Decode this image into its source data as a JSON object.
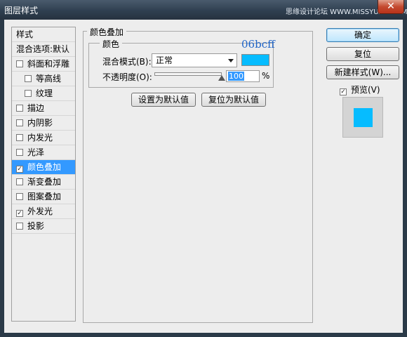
{
  "window": {
    "title": "图层样式",
    "watermark": "思缘设计论坛 WWW.MISSYUAN.COM",
    "close_glyph": "✕"
  },
  "left_panel": {
    "header": "样式",
    "blend_options": "混合选项:默认",
    "items": [
      {
        "label": "斜面和浮雕",
        "checked": false,
        "selected": false
      },
      {
        "label": "等高线",
        "checked": false,
        "selected": false,
        "indent": true
      },
      {
        "label": "纹理",
        "checked": false,
        "selected": false,
        "indent": true
      },
      {
        "label": "描边",
        "checked": false,
        "selected": false
      },
      {
        "label": "内阴影",
        "checked": false,
        "selected": false
      },
      {
        "label": "内发光",
        "checked": false,
        "selected": false
      },
      {
        "label": "光泽",
        "checked": false,
        "selected": false
      },
      {
        "label": "颜色叠加",
        "checked": true,
        "selected": true
      },
      {
        "label": "渐变叠加",
        "checked": false,
        "selected": false
      },
      {
        "label": "图案叠加",
        "checked": false,
        "selected": false
      },
      {
        "label": "外发光",
        "checked": true,
        "selected": false
      },
      {
        "label": "投影",
        "checked": false,
        "selected": false
      }
    ]
  },
  "main": {
    "section_title": "颜色叠加",
    "group_title": "颜色",
    "hex_note": "06bcff",
    "blend_mode_label": "混合模式(B):",
    "blend_mode_value": "正常",
    "overlay_color": "#06bcff",
    "opacity_label": "不透明度(O):",
    "opacity_value": "100",
    "opacity_unit": "%",
    "opacity_fraction": 1.0,
    "set_default_label": "设置为默认值",
    "reset_default_label": "复位为默认值"
  },
  "right": {
    "ok_label": "确定",
    "reset_label": "复位",
    "new_style_label": "新建样式(W)...",
    "preview_label": "预览(V)",
    "preview_checked": true
  },
  "colors": {
    "accent": "#3399ff",
    "overlay": "#06bcff"
  }
}
